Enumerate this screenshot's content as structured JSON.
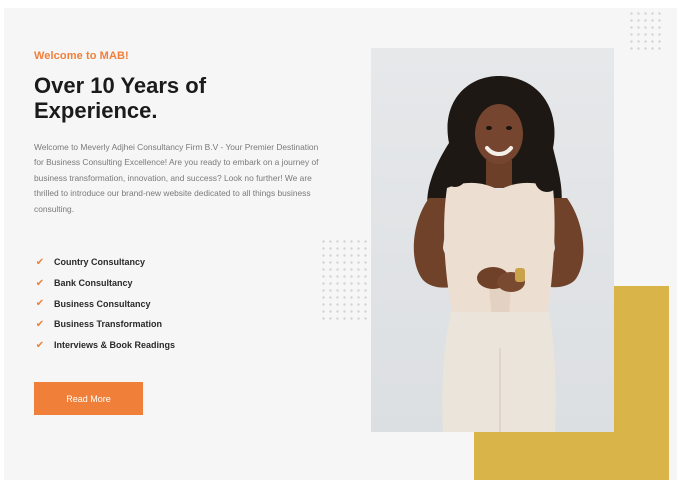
{
  "hero": {
    "eyebrow": "Welcome to MAB!",
    "headline_line1": "Over 10 Years of",
    "headline_line2": "Experience.",
    "intro": "Welcome to Meverly Adjhei Consultancy Firm B.V - Your Premier Destination for Business Consulting Excellence! Are you ready to embark on a journey of business transformation, innovation, and success? Look no further! We are thrilled to introduce our brand-new website dedicated to all things business consulting.",
    "services": [
      "Country Consultancy",
      "Bank Consultancy",
      "Business Consultancy",
      "Business Transformation",
      "Interviews & Book Readings"
    ],
    "check_icon": "check-icon",
    "cta_label": "Read More"
  },
  "colors": {
    "accent_orange": "#f07f3a",
    "accent_gold": "#d9b448",
    "panel_bg": "#f6f6f6",
    "heading": "#1b1b1b",
    "body_text": "#7a7a7a"
  }
}
